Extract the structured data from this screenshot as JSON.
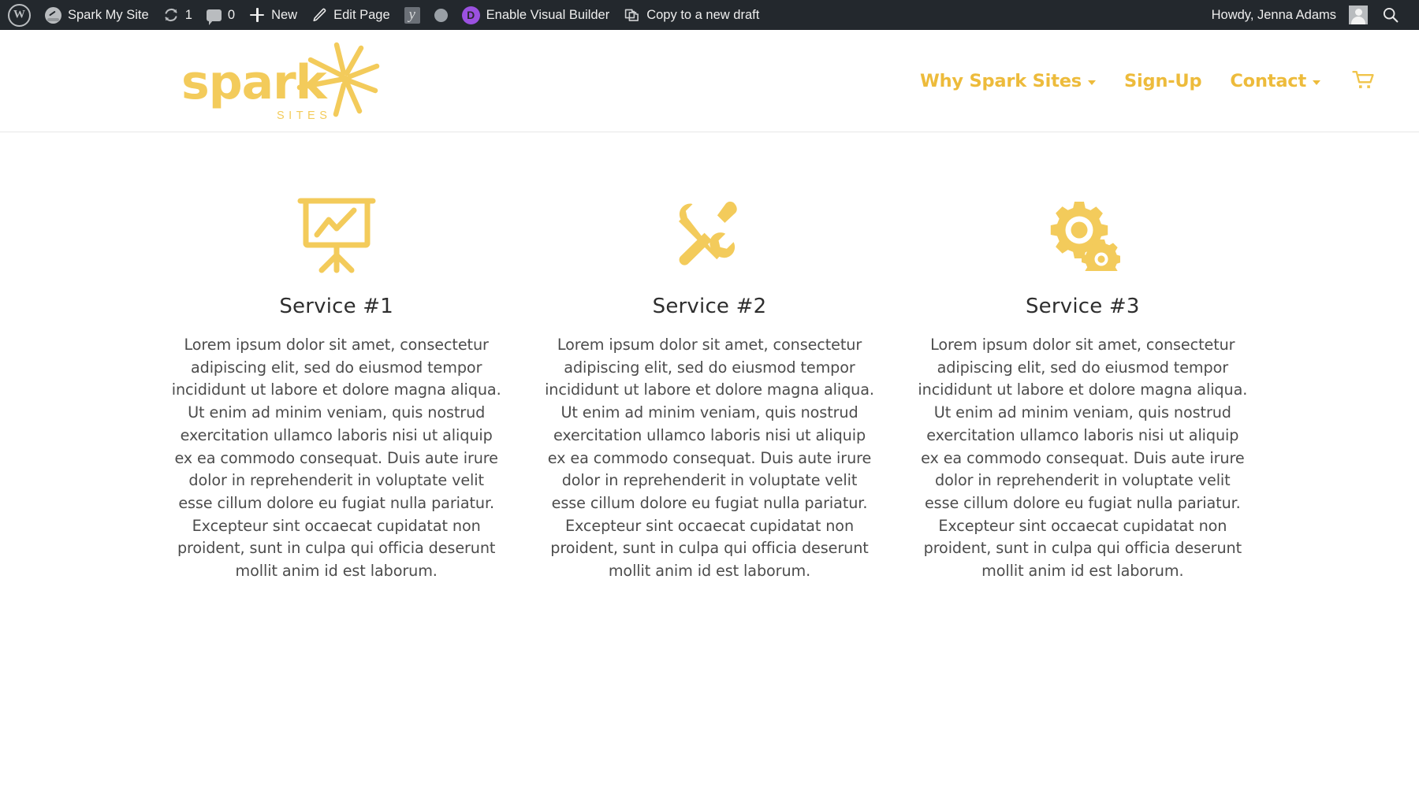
{
  "admin_bar": {
    "wp_logo": "wordpress-logo-icon",
    "site_name": "Spark My Site",
    "updates_count": "1",
    "comments_count": "0",
    "new_label": "New",
    "edit_page_label": "Edit Page",
    "yoast_label": "",
    "divi_badge": "D",
    "visual_builder_label": "Enable Visual Builder",
    "copy_draft_label": "Copy to a new draft",
    "howdy_label": "Howdy, Jenna Adams",
    "background_color": "#23282d",
    "divi_color": "#9b51e0"
  },
  "site_header": {
    "logo": {
      "word": "spark",
      "subtitle": "SITES",
      "color": "#f3cb5b"
    },
    "nav": {
      "accent_color": "#edbb3b",
      "items": [
        {
          "label": "Why Spark Sites",
          "has_dropdown": true
        },
        {
          "label": "Sign-Up",
          "has_dropdown": false
        },
        {
          "label": "Contact",
          "has_dropdown": true
        }
      ],
      "cart_icon": "shopping-cart-icon"
    }
  },
  "services": {
    "accent_color": "#f3cb5b",
    "columns": [
      {
        "icon": "presentation-chart-icon",
        "title": "Service #1",
        "body": "Lorem ipsum dolor sit amet, consectetur adipiscing elit, sed do eiusmod tempor incididunt ut labore et dolore magna aliqua. Ut enim ad minim veniam, quis nostrud exercitation ullamco laboris nisi ut aliquip ex ea commodo consequat. Duis aute irure dolor in reprehenderit in voluptate velit esse cillum dolore eu fugiat nulla pariatur. Excepteur sint occaecat cupidatat non proident, sunt in culpa qui officia deserunt mollit anim id est laborum."
      },
      {
        "icon": "wrench-screwdriver-icon",
        "title": "Service #2",
        "body": "Lorem ipsum dolor sit amet, consectetur adipiscing elit, sed do eiusmod tempor incididunt ut labore et dolore magna aliqua. Ut enim ad minim veniam, quis nostrud exercitation ullamco laboris nisi ut aliquip ex ea commodo consequat. Duis aute irure dolor in reprehenderit in voluptate velit esse cillum dolore eu fugiat nulla pariatur. Excepteur sint occaecat cupidatat non proident, sunt in culpa qui officia deserunt mollit anim id est laborum."
      },
      {
        "icon": "gears-icon",
        "title": "Service #3",
        "body": "Lorem ipsum dolor sit amet, consectetur adipiscing elit, sed do eiusmod tempor incididunt ut labore et dolore magna aliqua. Ut enim ad minim veniam, quis nostrud exercitation ullamco laboris nisi ut aliquip ex ea commodo consequat. Duis aute irure dolor in reprehenderit in voluptate velit esse cillum dolore eu fugiat nulla pariatur. Excepteur sint occaecat cupidatat non proident, sunt in culpa qui officia deserunt mollit anim id est laborum."
      }
    ]
  }
}
